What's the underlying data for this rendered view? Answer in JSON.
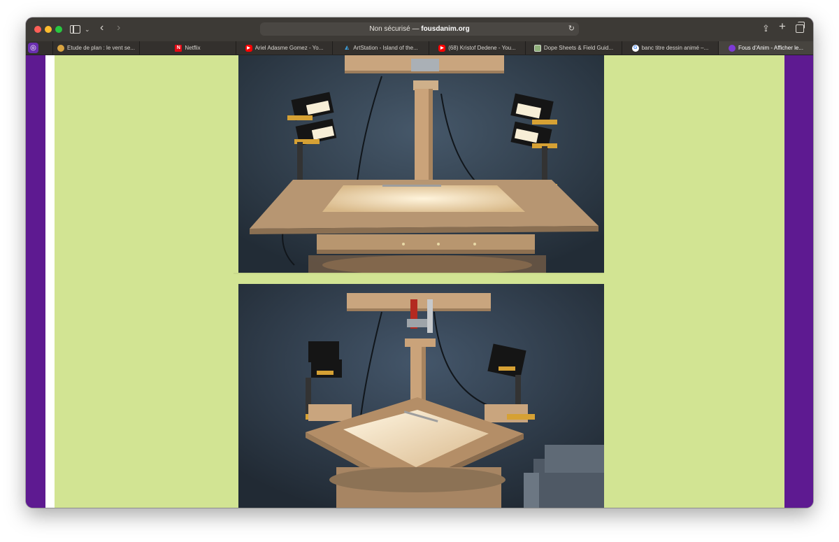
{
  "browser": {
    "address": {
      "security_label": "Non sécurisé — ",
      "host": "fousdanim.org"
    },
    "pinned_tab_icon": "fous-danim-favicon",
    "tabs": [
      {
        "label": "Etude de plan : le vent se...",
        "icon": "etude-favicon"
      },
      {
        "label": "Netflix",
        "icon": "netflix-favicon"
      },
      {
        "label": "Ariel Adasme Gomez - Yo...",
        "icon": "youtube-favicon"
      },
      {
        "label": "ArtStation - Island of the...",
        "icon": "artstation-favicon"
      },
      {
        "label": "(68) Kristof Dedene - You...",
        "icon": "youtube-favicon"
      },
      {
        "label": "Dope Sheets & Field Guid...",
        "icon": "dope-sheets-favicon"
      },
      {
        "label": "banc titre dessin animé –...",
        "icon": "google-favicon"
      },
      {
        "label": "Fous d'Anim - Afficher le...",
        "icon": "fous-danim-favicon",
        "active": true
      }
    ]
  },
  "page": {
    "images": [
      {
        "subject": "animation stand with lit glass plate and four lamps, front view"
      },
      {
        "subject": "animation stand with rotated lit glass plate and four lamps"
      }
    ]
  },
  "colors": {
    "toolbar": "#3d3a36",
    "page_frame": "#5e1a91",
    "page_background": "#d2e493"
  }
}
